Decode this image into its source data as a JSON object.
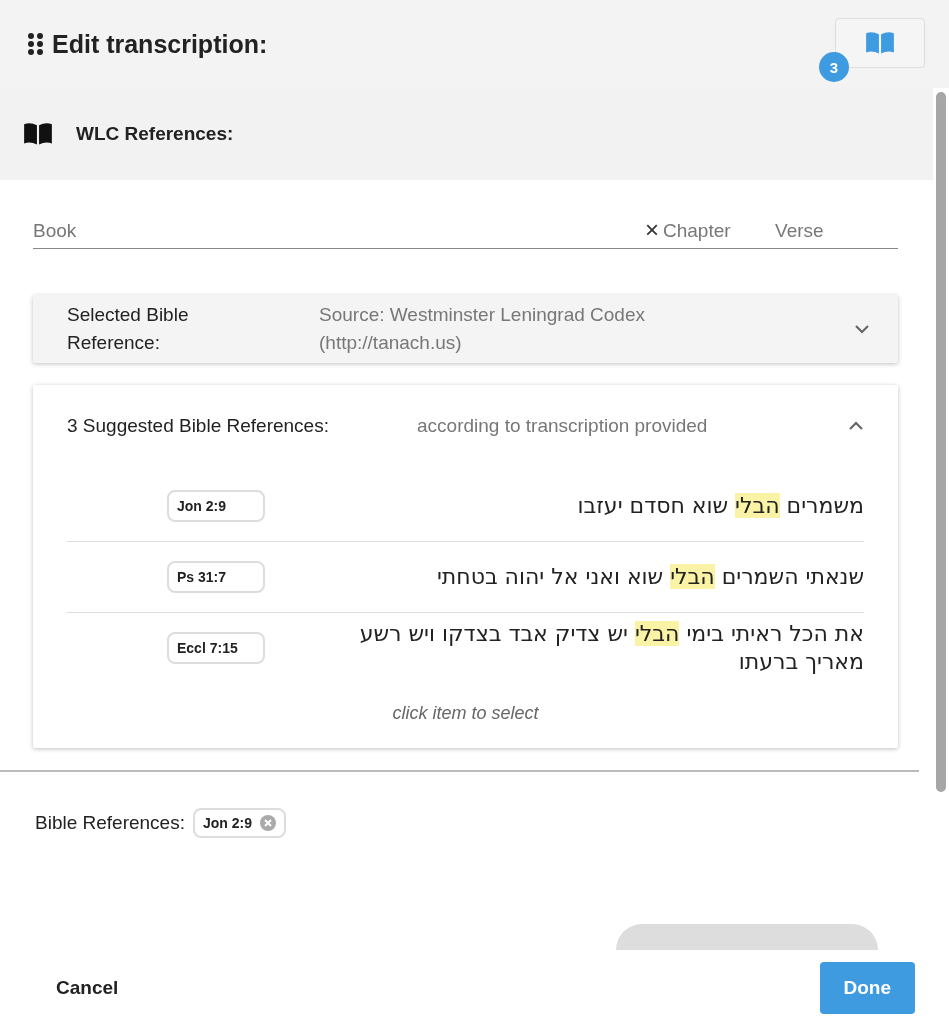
{
  "header": {
    "title": "Edit transcription:",
    "badge": "3"
  },
  "section": {
    "title": "WLC References:"
  },
  "search": {
    "book_placeholder": "Book",
    "clear": "×",
    "chapter_placeholder": "Chapter",
    "verse_placeholder": "Verse"
  },
  "selected_reference": {
    "label": "Selected Bible Reference:",
    "source": "Source: Westminster Leningrad Codex (http://tanach.us)",
    "expanded": false
  },
  "suggestions": {
    "title": "3 Suggested Bible References:",
    "subtitle": "according to transcription provided",
    "expanded": true,
    "hint": "click item to select",
    "items": [
      {
        "ref": "Jon 2:9",
        "segments": [
          {
            "text": "משמרים ",
            "highlighted": false
          },
          {
            "text": "הבלי",
            "highlighted": true
          },
          {
            "text": " שוא חסדם יעזבו",
            "highlighted": false
          }
        ]
      },
      {
        "ref": "Ps 31:7",
        "segments": [
          {
            "text": "שנאתי השמרים ",
            "highlighted": false
          },
          {
            "text": "הבלי",
            "highlighted": true
          },
          {
            "text": " שוא ואני אל יהוה בטחתי",
            "highlighted": false
          }
        ]
      },
      {
        "ref": "Eccl 7:15",
        "segments": [
          {
            "text": "את הכל ראיתי בימי ",
            "highlighted": false
          },
          {
            "text": "הבלי",
            "highlighted": true
          },
          {
            "text": " יש צדיק אבד בצדקו ויש רשע מאריך ברעתו",
            "highlighted": false
          }
        ]
      }
    ]
  },
  "bible_references": {
    "label": "Bible References:",
    "chips": [
      "Jon 2:9"
    ]
  },
  "footer": {
    "cancel": "Cancel",
    "done": "Done"
  }
}
